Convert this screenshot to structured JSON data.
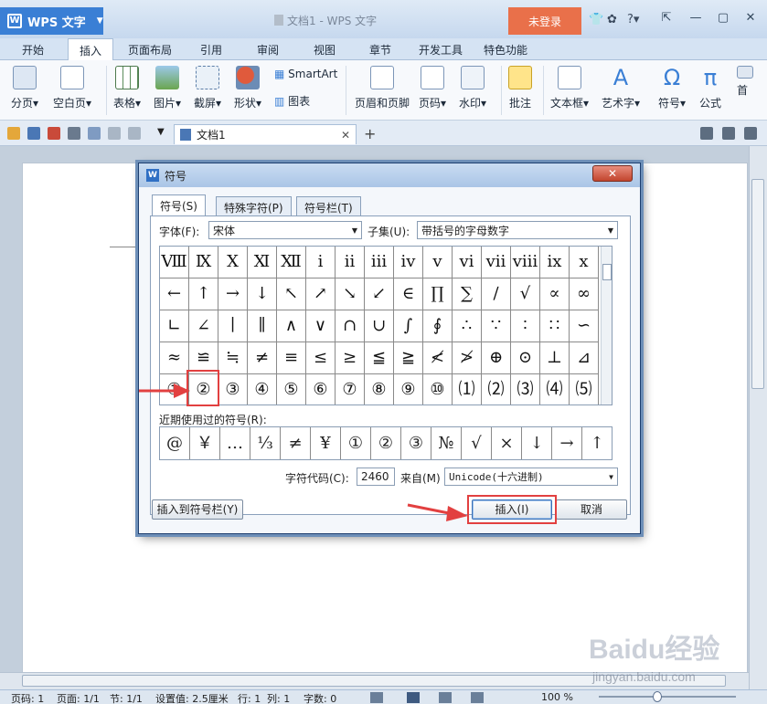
{
  "app": {
    "name": "WPS 文字",
    "window_title": "文档1 - WPS 文字",
    "login_button": "未登录"
  },
  "menu_tabs": [
    "开始",
    "插入",
    "页面布局",
    "引用",
    "审阅",
    "视图",
    "章节",
    "开发工具",
    "特色功能"
  ],
  "active_tab": "插入",
  "ribbon": {
    "page_break": "分页",
    "blank_page": "空白页",
    "table": "表格",
    "picture": "图片",
    "screenshot": "截屏",
    "shape": "形状",
    "smartart": "SmartArt",
    "chart": "图表",
    "header_footer": "页眉和页脚",
    "page_number": "页码",
    "watermark": "水印",
    "comment": "批注",
    "textbox": "文本框",
    "wordart": "艺术字",
    "symbol": "符号",
    "formula": "公式",
    "more1": "首"
  },
  "doc_tab": "文档1",
  "dialog": {
    "title": "符号",
    "tabs": [
      "符号(S)",
      "特殊字符(P)",
      "符号栏(T)"
    ],
    "font_label": "字体(F):",
    "font_value": "宋体",
    "subset_label": "子集(U):",
    "subset_value": "带括号的字母数字",
    "grid": [
      [
        "Ⅷ",
        "Ⅸ",
        "Ⅹ",
        "Ⅺ",
        "Ⅻ",
        "ⅰ",
        "ⅱ",
        "ⅲ",
        "ⅳ",
        "ⅴ",
        "ⅵ",
        "ⅶ",
        "ⅷ",
        "ⅸ",
        "ⅹ"
      ],
      [
        "←",
        "↑",
        "→",
        "↓",
        "↖",
        "↗",
        "↘",
        "↙",
        "∈",
        "∏",
        "∑",
        "∕",
        "√",
        "∝",
        "∞"
      ],
      [
        "∟",
        "∠",
        "∣",
        "∥",
        "∧",
        "∨",
        "∩",
        "∪",
        "∫",
        "∮",
        "∴",
        "∵",
        "∶",
        "∷",
        "∽"
      ],
      [
        "≈",
        "≌",
        "≒",
        "≠",
        "≡",
        "≤",
        "≥",
        "≦",
        "≧",
        "≮",
        "≯",
        "⊕",
        "⊙",
        "⊥",
        "⊿"
      ],
      [
        "①",
        "②",
        "③",
        "④",
        "⑤",
        "⑥",
        "⑦",
        "⑧",
        "⑨",
        "⑩",
        "⑴",
        "⑵",
        "⑶",
        "⑷",
        "⑸"
      ]
    ],
    "recent_label": "近期使用过的符号(R):",
    "recent": [
      "@",
      "￥",
      "…",
      "⅓",
      "≠",
      "¥",
      "①",
      "②",
      "③",
      "№",
      "√",
      "×",
      "↓",
      "→",
      "↑"
    ],
    "code_label": "字符代码(C):",
    "code_value": "2460",
    "from_label": "来自(M)",
    "from_value": "Unicode(十六进制)",
    "insert_to_bar": "插入到符号栏(Y)",
    "insert": "插入(I)",
    "cancel": "取消"
  },
  "status_bar": {
    "page_no": "页码: 1",
    "pages": "页面: 1/1",
    "section": "节: 1/1",
    "setting": "设置值: 2.5厘米",
    "row": "行: 1",
    "col": "列: 1",
    "words": "字数: 0",
    "zoom": "100 %"
  },
  "watermark_text": {
    "brand": "Baidu经验",
    "url": "jingyan.baidu.com"
  },
  "colors": {
    "accent": "#3a7fd5",
    "login": "#e9704a",
    "highlight": "#e24040"
  }
}
